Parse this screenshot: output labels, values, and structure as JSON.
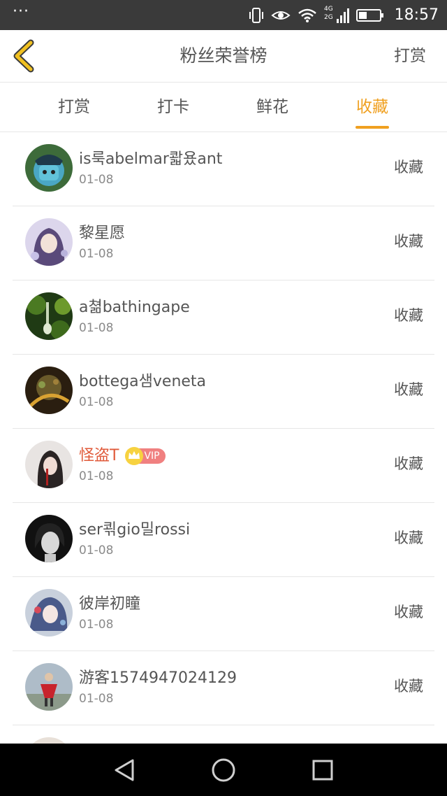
{
  "status_bar": {
    "dots": "···",
    "network": "4G 2G",
    "time": "18:57",
    "icons": [
      "vibrate-icon",
      "eye-icon",
      "wifi-icon",
      "signal-icon",
      "battery-icon"
    ]
  },
  "header": {
    "title": "粉丝荣誉榜",
    "action_label": "打赏",
    "accent_color": "#f0a020"
  },
  "tabs": [
    {
      "label": "打赏",
      "active": false
    },
    {
      "label": "打卡",
      "active": false
    },
    {
      "label": "鲜花",
      "active": false
    },
    {
      "label": "收藏",
      "active": true
    }
  ],
  "list": {
    "items": [
      {
        "name": "is룩abelmar콻욨ant",
        "date": "01-08",
        "action": "收藏",
        "vip": false
      },
      {
        "name": "黎星愿",
        "date": "01-08",
        "action": "收藏",
        "vip": false
      },
      {
        "name": "a쳚bathingape",
        "date": "01-08",
        "action": "收藏",
        "vip": false
      },
      {
        "name": "bottega샘veneta",
        "date": "01-08",
        "action": "收藏",
        "vip": false
      },
      {
        "name": "怪盗T",
        "date": "01-08",
        "action": "收藏",
        "vip": true,
        "badge": "VIP"
      },
      {
        "name": "ser쾪gio밀rossi",
        "date": "01-08",
        "action": "收藏",
        "vip": false
      },
      {
        "name": "彼岸初瞳",
        "date": "01-08",
        "action": "收藏",
        "vip": false
      },
      {
        "name": "游客1574947024129",
        "date": "01-08",
        "action": "收藏",
        "vip": false
      }
    ]
  },
  "nav_bar": {
    "buttons": [
      "back-triangle-icon",
      "home-circle-icon",
      "recents-square-icon"
    ]
  }
}
